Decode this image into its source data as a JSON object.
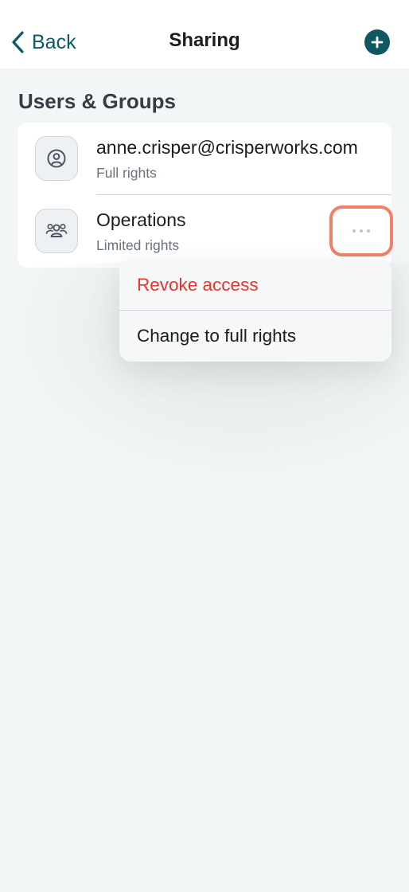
{
  "header": {
    "back_label": "Back",
    "title": "Sharing",
    "add_icon": "plus-circle-icon"
  },
  "section": {
    "title": "Users & Groups"
  },
  "entries": [
    {
      "name": "anne.crisper@crisperworks.com",
      "rights": "Full rights",
      "icon": "user-icon"
    },
    {
      "name": "Operations",
      "rights": "Limited rights",
      "icon": "group-icon"
    }
  ],
  "context_menu": {
    "items": [
      {
        "label": "Revoke access",
        "color": "#e8352b"
      },
      {
        "label": "Change to full rights",
        "color": "#1a1d1f"
      }
    ]
  },
  "colors": {
    "accent": "#0f5763",
    "highlight": "#f08067",
    "destructive": "#e8352b"
  }
}
